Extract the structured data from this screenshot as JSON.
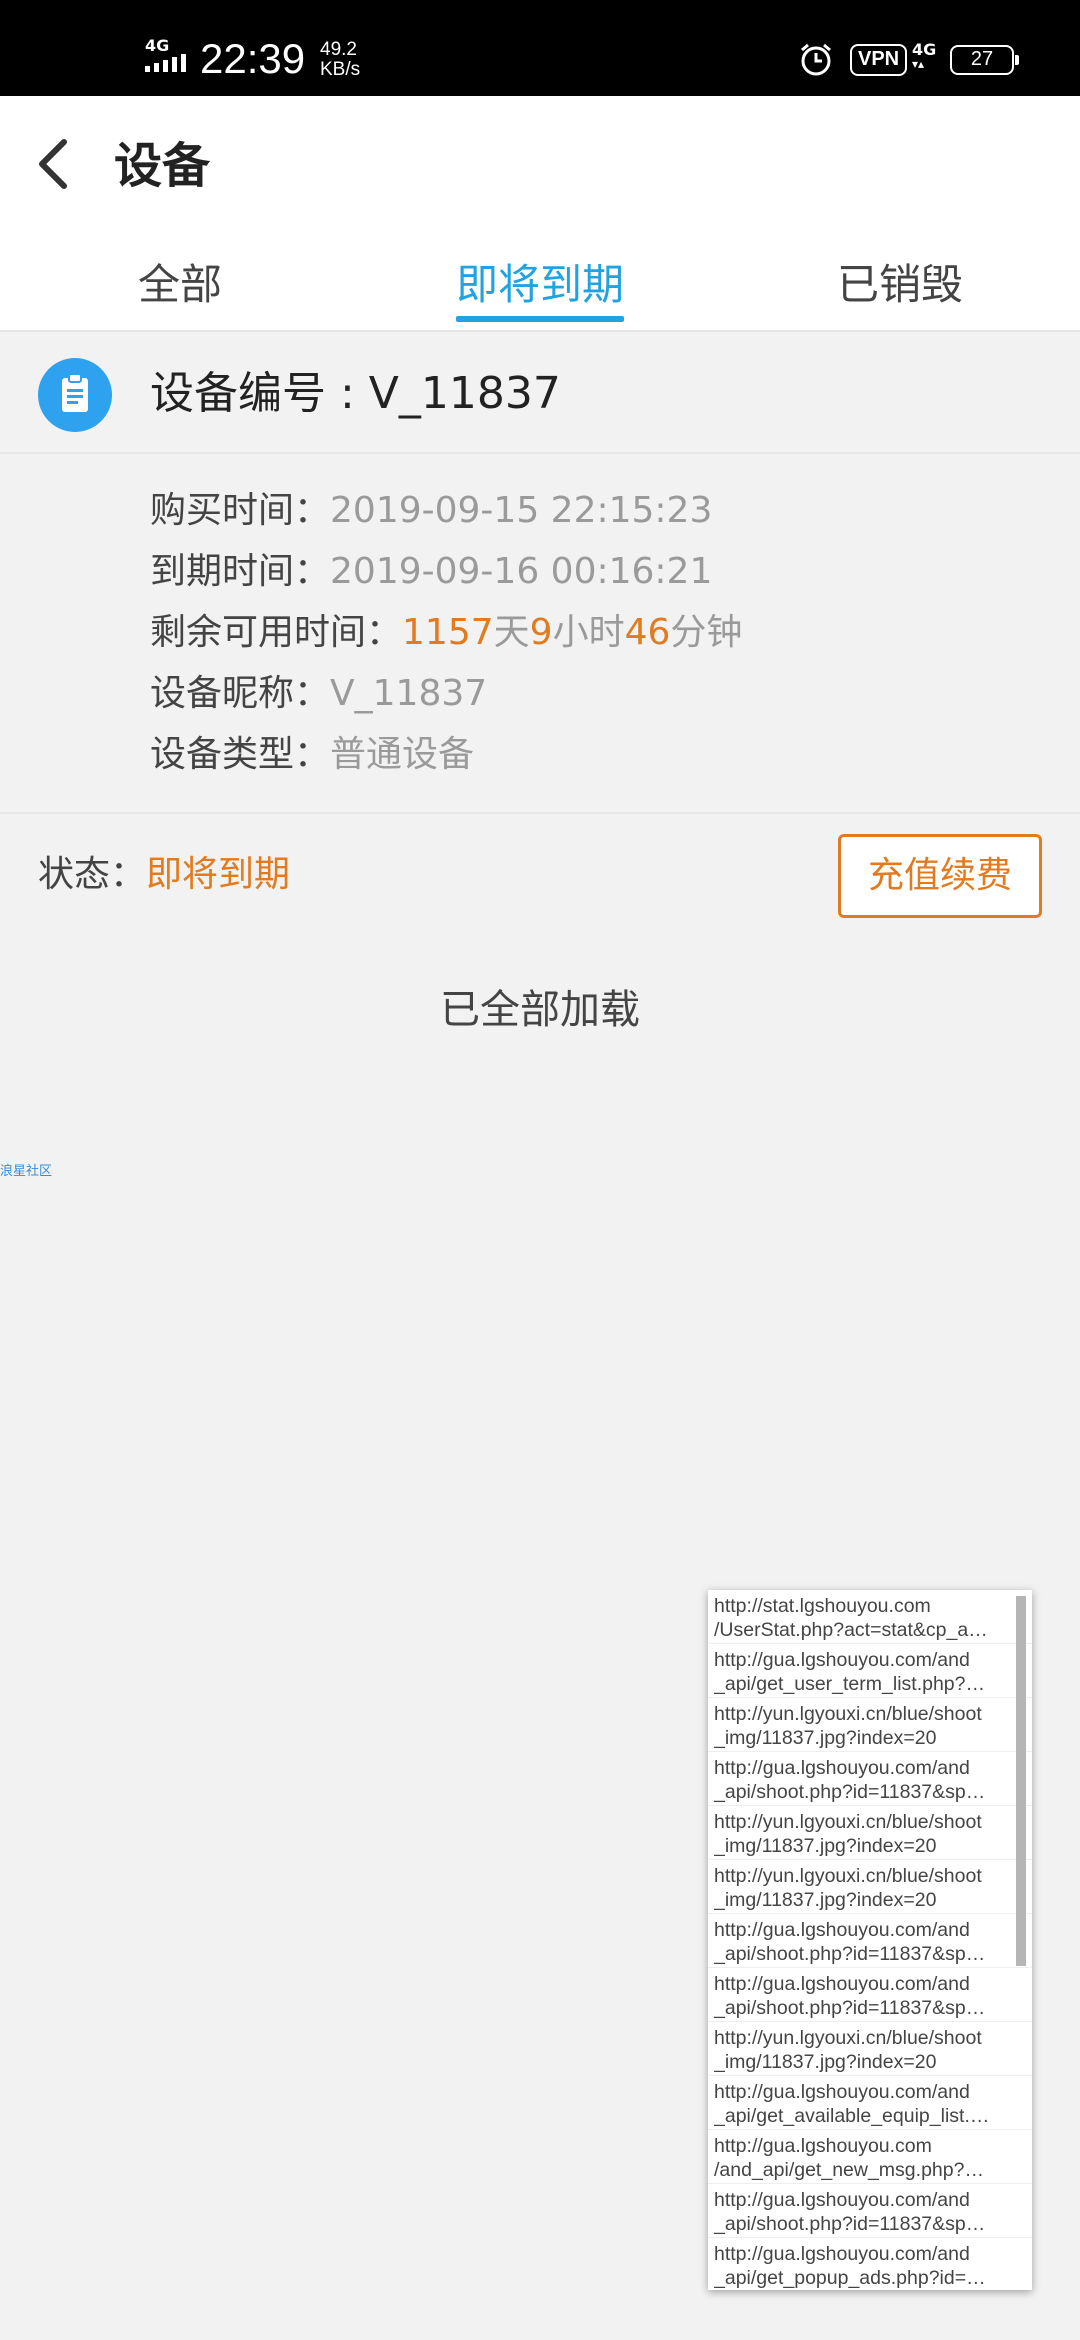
{
  "status_bar": {
    "network_label": "4G",
    "time": "22:39",
    "speed_value": "49.2",
    "speed_unit": "KB/s",
    "vpn": "VPN",
    "net2": "4G",
    "battery": "27",
    "icons": [
      "signal-icon",
      "alarm-icon",
      "vpn-icon",
      "network-icon",
      "battery-icon"
    ]
  },
  "header": {
    "title": "设备",
    "back_icon": "chevron-left-icon"
  },
  "tabs": [
    {
      "label": "全部",
      "active": false
    },
    {
      "label": "即将到期",
      "active": true
    },
    {
      "label": "已销毁",
      "active": false
    }
  ],
  "device": {
    "icon": "clipboard-icon",
    "id_label": "设备编号 : V_11837",
    "purchase_label": "购买时间：",
    "purchase_value": "2019-09-15  22:15:23",
    "expire_label": "到期时间：",
    "expire_value": "2019-09-16  00:16:21",
    "remaining_label": "剩余可用时间：",
    "remaining_days": "1157",
    "remaining_days_unit": "天",
    "remaining_hours": "9",
    "remaining_hours_unit": "小时",
    "remaining_minutes": "46",
    "remaining_minutes_unit": "分钟",
    "nickname_label": "设备昵称：",
    "nickname_value": "V_11837",
    "type_label": "设备类型：",
    "type_value": "普通设备",
    "status_label": "状态：",
    "status_value": "即将到期",
    "recharge_button": "充值续费"
  },
  "loaded_text": "已全部加载",
  "tiny_link": "浪星社区",
  "colors": {
    "accent": "#20a3e0",
    "warning": "#e27b1f",
    "icon_blue": "#2ea2ee"
  },
  "url_log": [
    [
      "http://stat.lgshouyou.com",
      "/UserStat.php?act=stat&cp_a…"
    ],
    [
      "http://gua.lgshouyou.com/and",
      "_api/get_user_term_list.php?…"
    ],
    [
      "http://yun.lgyouxi.cn/blue/shoot",
      "_img/11837.jpg?index=20"
    ],
    [
      "http://gua.lgshouyou.com/and",
      "_api/shoot.php?id=11837&sp…"
    ],
    [
      "http://yun.lgyouxi.cn/blue/shoot",
      "_img/11837.jpg?index=20"
    ],
    [
      "http://yun.lgyouxi.cn/blue/shoot",
      "_img/11837.jpg?index=20"
    ],
    [
      "http://gua.lgshouyou.com/and",
      "_api/shoot.php?id=11837&sp…"
    ],
    [
      "http://gua.lgshouyou.com/and",
      "_api/shoot.php?id=11837&sp…"
    ],
    [
      "http://yun.lgyouxi.cn/blue/shoot",
      "_img/11837.jpg?index=20"
    ],
    [
      "http://gua.lgshouyou.com/and",
      "_api/get_available_equip_list.…"
    ],
    [
      "http://gua.lgshouyou.com",
      "/and_api/get_new_msg.php?…"
    ],
    [
      "http://gua.lgshouyou.com/and",
      "_api/shoot.php?id=11837&sp…"
    ],
    [
      "http://gua.lgshouyou.com/and",
      "_api/get_popup_ads.php?id=…"
    ]
  ]
}
